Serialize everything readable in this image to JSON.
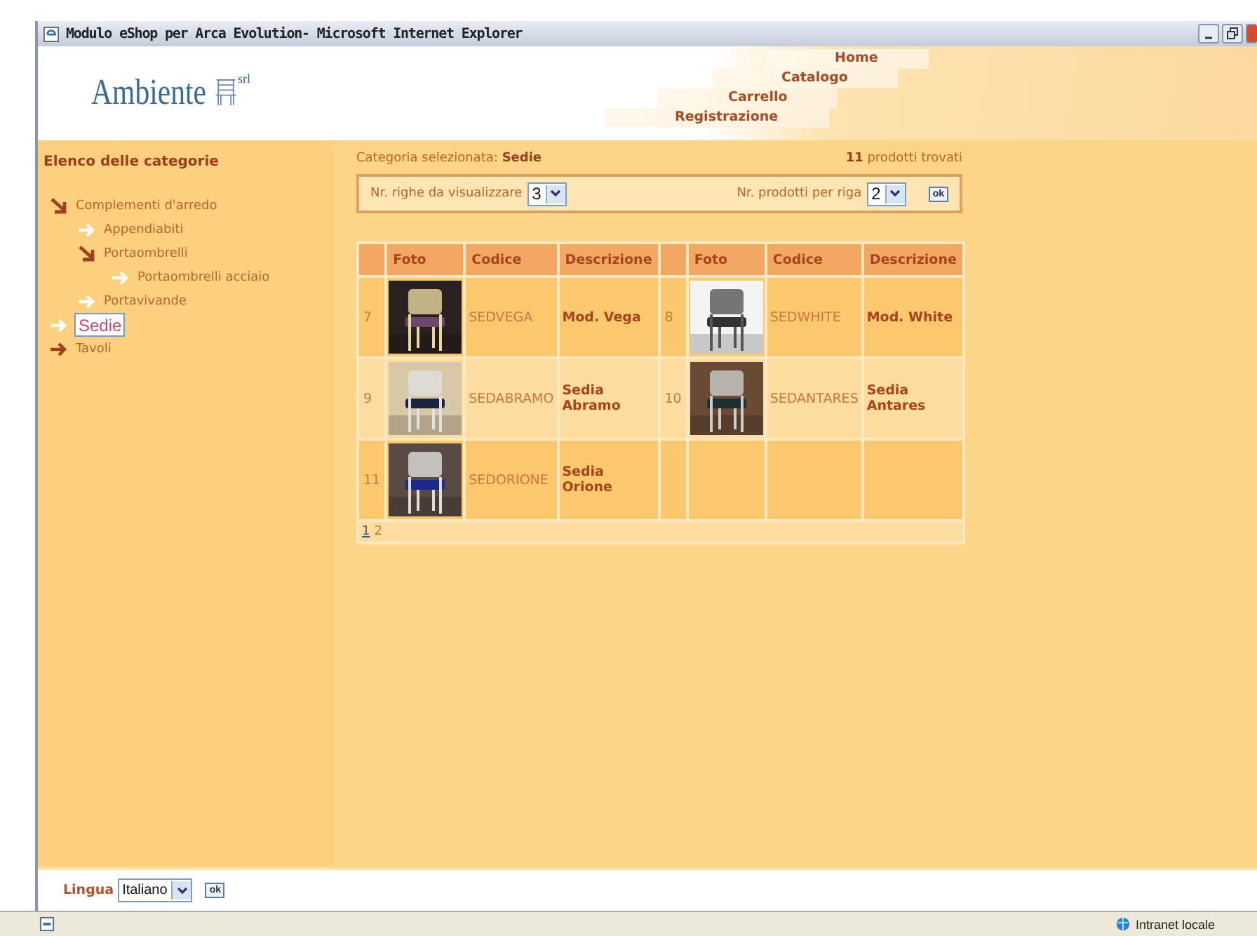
{
  "window": {
    "title": "Modulo eShop per Arca Evolution- Microsoft Internet Explorer"
  },
  "header": {
    "logo": "Ambiente",
    "logo_suffix": "srl",
    "menu": [
      "Home",
      "Catalogo",
      "Carrello",
      "Registrazione"
    ]
  },
  "sidebar": {
    "title": "Elenco delle categorie",
    "items": [
      {
        "label": "Complementi d'arredo",
        "kind": "branch",
        "expanded": true,
        "selected": false,
        "children": [
          {
            "label": "Appendiabiti",
            "kind": "leaf",
            "selected": false
          },
          {
            "label": "Portaombrelli",
            "kind": "branch",
            "expanded": true,
            "selected": false,
            "children": [
              {
                "label": "Portaombrelli acciaio",
                "kind": "leaf",
                "selected": false
              }
            ]
          },
          {
            "label": "Portavivande",
            "kind": "leaf",
            "selected": false
          }
        ]
      },
      {
        "label": "Sedie",
        "kind": "leaf",
        "selected": true
      },
      {
        "label": "Tavoli",
        "kind": "branch",
        "expanded": false,
        "selected": false
      }
    ]
  },
  "summary": {
    "label": "Categoria selezionata:",
    "category": "Sedie",
    "count": "11",
    "count_label": "prodotti trovati"
  },
  "filters": {
    "rows_label": "Nr. righe da visualizzare",
    "rows_value": "3",
    "per_row_label": "Nr. prodotti per riga",
    "per_row_value": "2",
    "submit": "ok"
  },
  "table": {
    "column_groups": [
      [
        "Foto",
        "Codice",
        "Descrizione"
      ],
      [
        "Foto",
        "Codice",
        "Descrizione"
      ]
    ],
    "rows": [
      {
        "products": [
          {
            "number": "7",
            "code": "SEDVEGA",
            "description": "Mod. Vega"
          },
          {
            "number": "8",
            "code": "SEDWHITE",
            "description": "Mod. White"
          }
        ]
      },
      {
        "products": [
          {
            "number": "9",
            "code": "SEDABRAMO",
            "description": "Sedia Abramo"
          },
          {
            "number": "10",
            "code": "SEDANTARES",
            "description": "Sedia Antares"
          }
        ]
      },
      {
        "products": [
          {
            "number": "11",
            "code": "SEDORIONE",
            "description": "Sedia Orione"
          }
        ]
      }
    ],
    "pages": [
      {
        "label": "1",
        "selected": true
      },
      {
        "label": "2",
        "selected": false
      }
    ]
  },
  "footer": {
    "language_label": "Lingua",
    "language": "Italiano",
    "submit": "ok"
  },
  "status_bar": {
    "zone": "Intranet locale"
  }
}
